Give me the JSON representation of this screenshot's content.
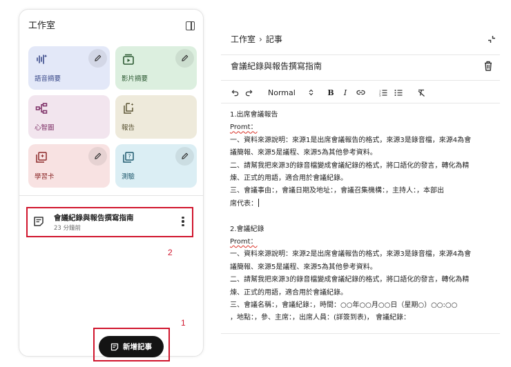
{
  "studio": {
    "title": "工作室",
    "tiles": [
      {
        "label": "語音摘要",
        "icon": "audio-waveform-icon",
        "editable": true
      },
      {
        "label": "影片摘要",
        "icon": "video-summary-icon",
        "editable": true
      },
      {
        "label": "心智圖",
        "icon": "mind-map-icon",
        "editable": false
      },
      {
        "label": "報告",
        "icon": "report-icon",
        "editable": false
      },
      {
        "label": "學習卡",
        "icon": "flashcard-icon",
        "editable": true
      },
      {
        "label": "測驗",
        "icon": "quiz-icon",
        "editable": true
      }
    ],
    "note": {
      "title": "會議紀錄與報告撰寫指南",
      "time": "23 分鐘前"
    },
    "add_note_label": "新增記事"
  },
  "annotations": {
    "marker_1": "1",
    "marker_2": "2"
  },
  "editor": {
    "breadcrumb_root": "工作室",
    "breadcrumb_separator": "›",
    "breadcrumb_current": "記事",
    "title": "會議紀錄與報告撰寫指南",
    "toolbar": {
      "format": "Normal",
      "bold": "B",
      "italic": "I"
    },
    "lines": [
      "1.出席會議報告",
      "Promt：",
      "一、資料來源說明：來源1是出席會議報告的格式，來源3是錄音檔，來源4為會",
      "議簡報、來源5是議程、來源5為其他參考資料。",
      "二、請幫我把來源3的錄音檔變成會議紀錄的格式，將口語化的發言，轉化為精",
      "煉、正式的用語，適合用於會議紀錄。",
      "三、會議事由：，會議日期及地址：，會議召集機構：，主持人：，本部出",
      "席代表：",
      "",
      "2.會議紀錄",
      "Promt：",
      "一、資料來源說明：來源2是出席會議報告的格式，來源3是錄音檔，來源4為會",
      "議簡報、來源5是議程、來源5為其他參考資料。",
      "二、請幫我把來源3的錄音檔變成會議紀錄的格式，將口語化的發言，轉化為精",
      "煉、正式的用語，適合用於會議紀錄。",
      "三、會議名稱：，會議紀錄：，時間：○○年○○月○○日（星期○）○○:○○",
      "，地點：，參、主席：，出席人員：(詳簽到表)，  會議紀錄："
    ]
  },
  "colors": {
    "annotation_red": "#d0142c",
    "button_dark": "#141414"
  }
}
